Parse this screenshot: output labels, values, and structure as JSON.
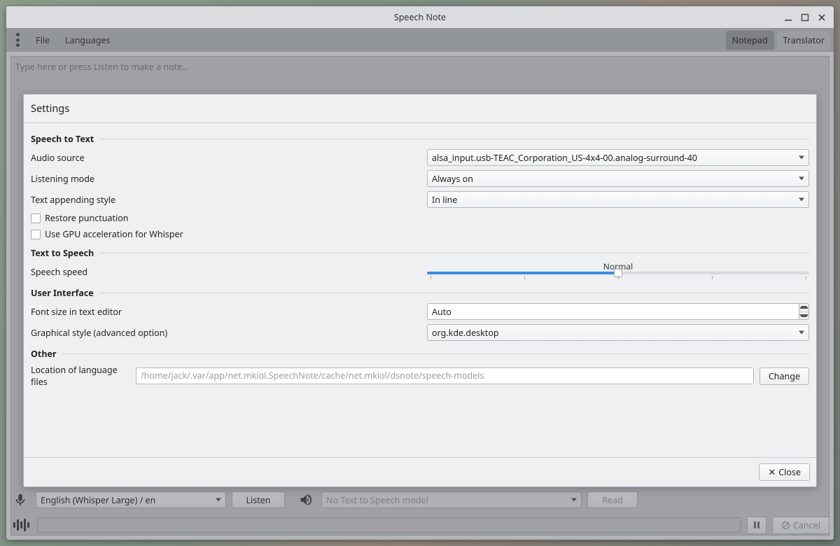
{
  "titlebar": {
    "title": "Speech Note"
  },
  "menubar": {
    "file": "File",
    "languages": "Languages",
    "tabs": {
      "notepad": "Notepad",
      "translator": "Translator"
    }
  },
  "note": {
    "placeholder": "Type here or press Listen to make a note..."
  },
  "settings": {
    "title": "Settings",
    "sections": {
      "stt": "Speech to Text",
      "tts": "Text to Speech",
      "ui": "User Interface",
      "other": "Other"
    },
    "stt": {
      "audio_source_label": "Audio source",
      "audio_source_value": "alsa_input.usb-TEAC_Corporation_US-4x4-00.analog-surround-40",
      "listening_mode_label": "Listening mode",
      "listening_mode_value": "Always on",
      "append_style_label": "Text appending style",
      "append_style_value": "In line",
      "restore_punct": "Restore punctuation",
      "gpu_whisper": "Use GPU acceleration for Whisper"
    },
    "tts": {
      "speed_label": "Speech speed",
      "speed_value_text": "Normal",
      "speed_percent": 50
    },
    "ui": {
      "font_label": "Font size in text editor",
      "font_value": "Auto",
      "style_label": "Graphical style (advanced option)",
      "style_value": "org.kde.desktop"
    },
    "other": {
      "loc_label": "Location of language files",
      "loc_placeholder": "/home/jack/.var/app/net.mkiol.SpeechNote/cache/net.mkiol/dsnote/speech-models",
      "change": "Change"
    },
    "close": "Close"
  },
  "bottom": {
    "stt_model": "English (Whisper Large) / en",
    "listen": "Listen",
    "tts_model_placeholder": "No Text to Speech model",
    "read": "Read",
    "cancel": "Cancel"
  }
}
